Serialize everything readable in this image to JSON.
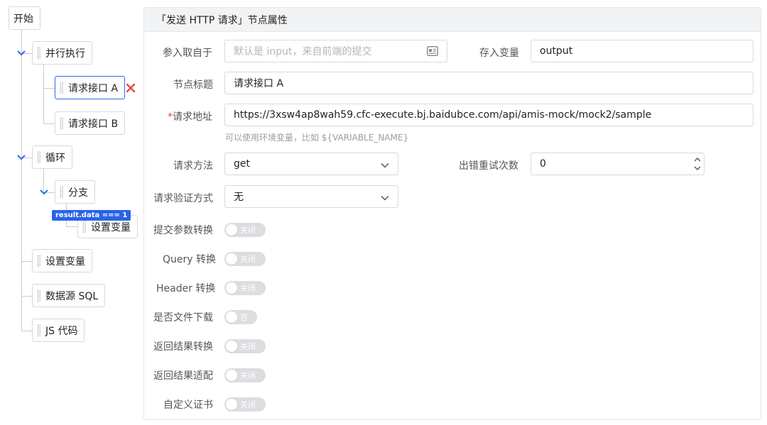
{
  "tree": {
    "start": "开始",
    "parallel": "并行执行",
    "api_a": "请求接口 A",
    "api_b": "请求接口 B",
    "loop": "循环",
    "branch": "分支",
    "condition": "result.data === 1",
    "set_var_branch": "设置变量",
    "set_var": "设置变量",
    "datasource_sql": "数据源 SQL",
    "js_code": "JS 代码"
  },
  "panel": {
    "title": "「发送 HTTP 请求」节点属性",
    "param_source": {
      "label": "参入取自于",
      "placeholder": "默认是 input，来自前端的提交"
    },
    "store_var": {
      "label": "存入变量",
      "value": "output"
    },
    "node_title": {
      "label": "节点标题",
      "value": "请求接口 A"
    },
    "url": {
      "required_mark": "*",
      "label": "请求地址",
      "value": "https://3xsw4ap8wah59.cfc-execute.bj.baidubce.com/api/amis-mock/mock2/sample",
      "hint": "可以使用环境变量，比如 ${VARIABLE_NAME}"
    },
    "method": {
      "label": "请求方法",
      "value": "get"
    },
    "retry": {
      "label": "出错重试次数",
      "value": "0"
    },
    "auth": {
      "label": "请求验证方式",
      "value": "无"
    },
    "toggles": [
      {
        "label": "提交参数转换",
        "state": "关闭"
      },
      {
        "label": "Query 转换",
        "state": "关闭"
      },
      {
        "label": "Header 转换",
        "state": "关闭"
      },
      {
        "label": "是否文件下载",
        "state": "否"
      },
      {
        "label": "返回结果转换",
        "state": "关闭"
      },
      {
        "label": "返回结果适配",
        "state": "关闭"
      },
      {
        "label": "自定义证书",
        "state": "关闭"
      }
    ]
  },
  "colors": {
    "accent": "#2a6cf3",
    "badge": "#2a63e8",
    "delete": "#e5493a",
    "toggle_off": "#dcdde0",
    "panel_header": "#f2f3f5"
  }
}
